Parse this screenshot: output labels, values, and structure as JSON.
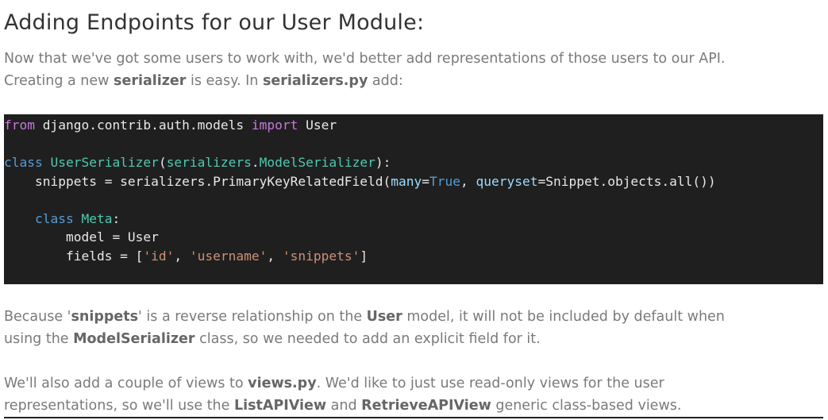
{
  "heading": "Adding Endpoints for our User Module:",
  "intro": {
    "line1": "Now that we've got some users to work with, we'd better add representations of those users to our API.",
    "line2_a": "Creating a new ",
    "line2_b": "serializer",
    "line2_c": " is easy. In ",
    "line2_d": "serializers.py",
    "line2_e": " add:"
  },
  "code": {
    "l1_from": "from",
    "l1_mod": " django.contrib.auth.models ",
    "l1_import": "import",
    "l1_name": " User",
    "l3_class": "class",
    "l3_name": "UserSerializer",
    "l3_paren": "(",
    "l3_base_mod": "serializers",
    "l3_dot": ".",
    "l3_base": "ModelSerializer",
    "l3_end": "):",
    "l4_a": "    snippets = serializers.PrimaryKeyRelatedField(",
    "l4_p1": "many",
    "l4_eq1": "=",
    "l4_v1": "True",
    "l4_comma": ", ",
    "l4_p2": "queryset",
    "l4_rest": "=Snippet.objects.all())",
    "l6_indent": "    ",
    "l6_class": "class",
    "l6_name": "Meta",
    "l6_colon": ":",
    "l7": "        model = User",
    "l8_a": "        fields = [",
    "l8_s1": "'id'",
    "l8_c1": ", ",
    "l8_s2": "'username'",
    "l8_c2": ", ",
    "l8_s3": "'snippets'",
    "l8_end": "]"
  },
  "para2": {
    "a": "Because '",
    "b": "snippets",
    "c": "' is a reverse relationship on the ",
    "d": "User",
    "e": " model, it will not be included by default when",
    "f": "using the ",
    "g": "ModelSerializer",
    "h": " class, so we needed to add an explicit field for it."
  },
  "para3": {
    "a": "We'll also add a couple of views to ",
    "b": "views.py",
    "c": ". We'd like to just use read-only views for the user",
    "d": "representations, so we'll use the ",
    "e": "ListAPIView",
    "f": " and ",
    "g": "RetrieveAPIView",
    "h": " generic class-based views."
  }
}
